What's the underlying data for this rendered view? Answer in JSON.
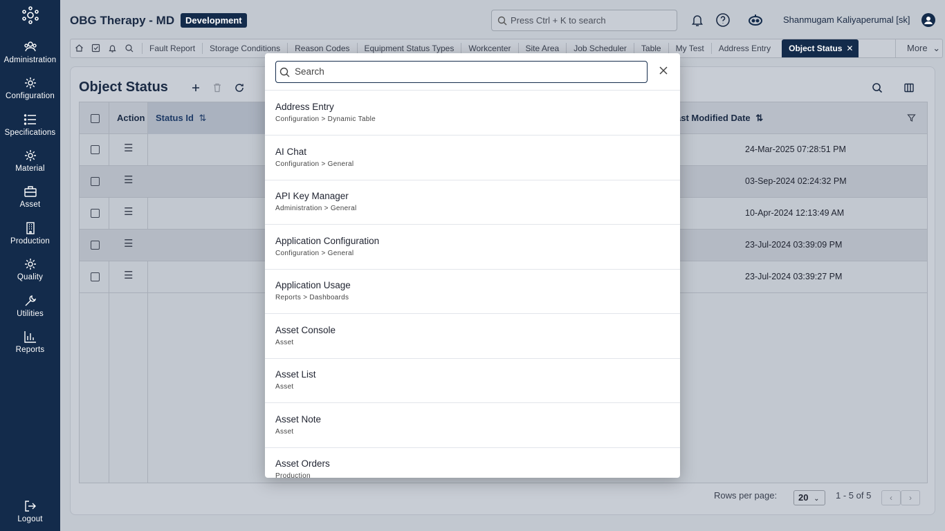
{
  "app": {
    "title": "OBG Therapy - MD",
    "env_badge": "Development",
    "search_placeholder": "Press Ctrl + K to search",
    "user": "Shanmugam Kaliyaperumal [sk]"
  },
  "sidebar": {
    "items": [
      {
        "label": "Administration",
        "icon": "people-icon"
      },
      {
        "label": "Configuration",
        "icon": "gear-icon"
      },
      {
        "label": "Specifications",
        "icon": "list-icon"
      },
      {
        "label": "Material",
        "icon": "gear-icon"
      },
      {
        "label": "Asset",
        "icon": "toolbox-icon"
      },
      {
        "label": "Production",
        "icon": "building-icon"
      },
      {
        "label": "Quality",
        "icon": "gear-icon"
      },
      {
        "label": "Utilities",
        "icon": "wrench-icon"
      },
      {
        "label": "Reports",
        "icon": "bar-chart-icon"
      }
    ],
    "logout": "Logout"
  },
  "tabs": [
    "Fault Report",
    "Storage Conditions",
    "Reason Codes",
    "Equipment Status Types",
    "Workcenter",
    "Site Area",
    "Job Scheduler",
    "Table",
    "My Test",
    "Address Entry"
  ],
  "active_tab": "Object Status",
  "more_tab": "More",
  "page": {
    "title": "Object Status"
  },
  "grid": {
    "columns": {
      "action": "Action",
      "status_id": "Status Id",
      "last_modified": "ast Modified Date"
    },
    "rows": [
      {
        "date": "24-Mar-2025 07:28:51 PM"
      },
      {
        "date": "03-Sep-2024 02:24:32 PM"
      },
      {
        "date": "10-Apr-2024 12:13:49 AM"
      },
      {
        "date": "23-Jul-2024 03:39:09 PM"
      },
      {
        "date": "23-Jul-2024 03:39:27 PM"
      }
    ]
  },
  "footer": {
    "rows_per_page_label": "Rows per page:",
    "rows_per_page": "20",
    "range": "1 - 5 of 5"
  },
  "modal": {
    "search_placeholder": "Search",
    "results": [
      {
        "title": "Address Entry",
        "path": "Configuration > Dynamic Table"
      },
      {
        "title": "AI Chat",
        "path": "Configuration > General"
      },
      {
        "title": "API Key Manager",
        "path": "Administration > General"
      },
      {
        "title": "Application Configuration",
        "path": "Configuration > General"
      },
      {
        "title": "Application Usage",
        "path": "Reports > Dashboards"
      },
      {
        "title": "Asset Console",
        "path": "Asset"
      },
      {
        "title": "Asset List",
        "path": "Asset"
      },
      {
        "title": "Asset Note",
        "path": "Asset"
      },
      {
        "title": "Asset Orders",
        "path": "Production"
      }
    ]
  },
  "colors": {
    "navy": "#132b4b",
    "overlay_bg": "#c2c8d0"
  }
}
